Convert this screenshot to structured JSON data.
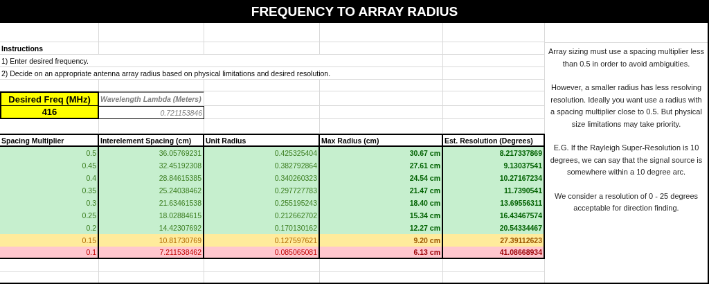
{
  "title": "FREQUENCY TO ARRAY RADIUS",
  "instructions": {
    "heading": "Instructions",
    "steps": [
      "1) Enter desired frequency.",
      "2) Decide on an appropriate antenna array radius based on physical limitations and desired resolution."
    ]
  },
  "frequency": {
    "label": "Desired Freq (MHz)",
    "value": "416"
  },
  "wavelength": {
    "label": "Wavelength Lambda (Meters)",
    "value": "0.721153846"
  },
  "table": {
    "columns": [
      "Spacing Multiplier",
      "Interelement Spacing (cm)",
      "Unit Radius",
      "Max Radius (cm)",
      "Est. Resolution (Degrees)"
    ],
    "rows": [
      {
        "kind": "good",
        "cells": [
          "0.5",
          "36.05769231",
          "0.425325404",
          "30.67 cm",
          "8.217337869"
        ]
      },
      {
        "kind": "good",
        "cells": [
          "0.45",
          "32.45192308",
          "0.382792864",
          "27.61 cm",
          "9.13037541"
        ]
      },
      {
        "kind": "good",
        "cells": [
          "0.4",
          "28.84615385",
          "0.340260323",
          "24.54 cm",
          "10.27167234"
        ]
      },
      {
        "kind": "good",
        "cells": [
          "0.35",
          "25.24038462",
          "0.297727783",
          "21.47 cm",
          "11.7390541"
        ]
      },
      {
        "kind": "good",
        "cells": [
          "0.3",
          "21.63461538",
          "0.255195243",
          "18.40 cm",
          "13.69556311"
        ]
      },
      {
        "kind": "good",
        "cells": [
          "0.25",
          "18.02884615",
          "0.212662702",
          "15.34 cm",
          "16.43467574"
        ]
      },
      {
        "kind": "good",
        "cells": [
          "0.2",
          "14.42307692",
          "0.170130162",
          "12.27 cm",
          "20.54334467"
        ]
      },
      {
        "kind": "marginal",
        "cells": [
          "0.15",
          "10.81730769",
          "0.127597621",
          "9.20 cm",
          "27.39112623"
        ]
      },
      {
        "kind": "poor",
        "cells": [
          "0.1",
          "7.211538462",
          "0.085065081",
          "6.13 cm",
          "41.08668934"
        ]
      }
    ]
  },
  "notes": [
    "Array sizing must use a spacing multiplier less than 0.5 in order to avoid ambiguities.",
    "However, a smaller radius has less resolving resolution. Ideally you want use a radius with a spacing multiplier close to 0.5. But physical size limitations may take priority.",
    "E.G. If the Rayleigh Super-Resolution is 10 degrees, we can say that the signal source is somewhere within a 10 degree arc.",
    "We consider a resolution of 0 - 25 degrees acceptable for direction finding."
  ]
}
